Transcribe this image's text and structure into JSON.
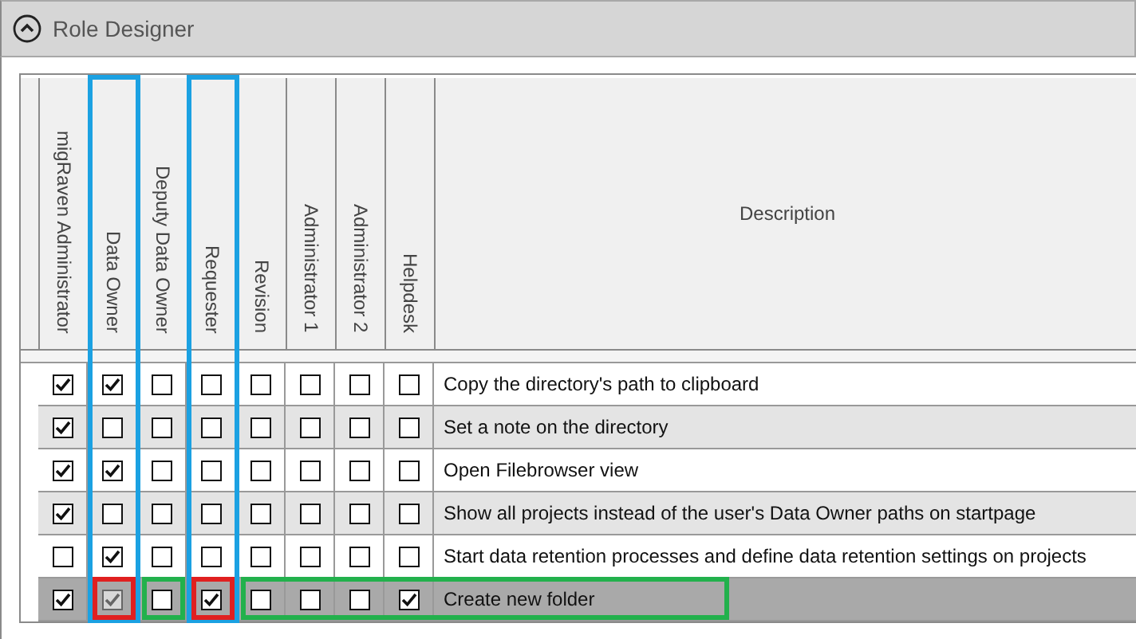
{
  "panel": {
    "title": "Role Designer",
    "expanded": true
  },
  "table": {
    "columns": [
      {
        "label": "migRaven Administrator"
      },
      {
        "label": "Data Owner"
      },
      {
        "label": "Deputy Data Owner"
      },
      {
        "label": "Requester"
      },
      {
        "label": "Revision"
      },
      {
        "label": "Administrator 1"
      },
      {
        "label": "Administrator 2"
      },
      {
        "label": "Helpdesk"
      },
      {
        "label": "Description"
      }
    ],
    "rows": [
      {
        "selected": false,
        "description": "Copy the directory's path to clipboard",
        "cells": [
          {
            "checked": true,
            "disabled": false
          },
          {
            "checked": true,
            "disabled": false
          },
          {
            "checked": false,
            "disabled": false
          },
          {
            "checked": false,
            "disabled": false
          },
          {
            "checked": false,
            "disabled": false
          },
          {
            "checked": false,
            "disabled": false
          },
          {
            "checked": false,
            "disabled": false
          },
          {
            "checked": false,
            "disabled": false
          }
        ]
      },
      {
        "selected": false,
        "description": "Set a note on the directory",
        "cells": [
          {
            "checked": true,
            "disabled": false
          },
          {
            "checked": false,
            "disabled": false
          },
          {
            "checked": false,
            "disabled": false
          },
          {
            "checked": false,
            "disabled": false
          },
          {
            "checked": false,
            "disabled": false
          },
          {
            "checked": false,
            "disabled": false
          },
          {
            "checked": false,
            "disabled": false
          },
          {
            "checked": false,
            "disabled": false
          }
        ]
      },
      {
        "selected": false,
        "description": "Open Filebrowser view",
        "cells": [
          {
            "checked": true,
            "disabled": false
          },
          {
            "checked": true,
            "disabled": false
          },
          {
            "checked": false,
            "disabled": false
          },
          {
            "checked": false,
            "disabled": false
          },
          {
            "checked": false,
            "disabled": false
          },
          {
            "checked": false,
            "disabled": false
          },
          {
            "checked": false,
            "disabled": false
          },
          {
            "checked": false,
            "disabled": false
          }
        ]
      },
      {
        "selected": false,
        "description": "Show all projects instead of the user's Data Owner paths on startpage",
        "cells": [
          {
            "checked": true,
            "disabled": false
          },
          {
            "checked": false,
            "disabled": false
          },
          {
            "checked": false,
            "disabled": false
          },
          {
            "checked": false,
            "disabled": false
          },
          {
            "checked": false,
            "disabled": false
          },
          {
            "checked": false,
            "disabled": false
          },
          {
            "checked": false,
            "disabled": false
          },
          {
            "checked": false,
            "disabled": false
          }
        ]
      },
      {
        "selected": false,
        "description": "Start data retention processes and define data retention settings on projects",
        "cells": [
          {
            "checked": false,
            "disabled": false
          },
          {
            "checked": true,
            "disabled": false
          },
          {
            "checked": false,
            "disabled": false
          },
          {
            "checked": false,
            "disabled": false
          },
          {
            "checked": false,
            "disabled": false
          },
          {
            "checked": false,
            "disabled": false
          },
          {
            "checked": false,
            "disabled": false
          },
          {
            "checked": false,
            "disabled": false
          }
        ]
      },
      {
        "selected": true,
        "description": "Create new folder",
        "cells": [
          {
            "checked": true,
            "disabled": false
          },
          {
            "checked": true,
            "disabled": true
          },
          {
            "checked": false,
            "disabled": false
          },
          {
            "checked": true,
            "disabled": false
          },
          {
            "checked": false,
            "disabled": false
          },
          {
            "checked": false,
            "disabled": false
          },
          {
            "checked": false,
            "disabled": false
          },
          {
            "checked": true,
            "disabled": false
          }
        ]
      }
    ]
  },
  "annotations": [
    {
      "kind": "column-frame",
      "color": "#1ba1e2"
    },
    {
      "kind": "column-frame",
      "color": "#1ba1e2"
    },
    {
      "kind": "cell-frame",
      "color": "#e02020"
    },
    {
      "kind": "cell-frame",
      "color": "#e02020"
    },
    {
      "kind": "cell-frame",
      "color": "#22b14c"
    },
    {
      "kind": "cell-frame",
      "color": "#22b14c"
    }
  ]
}
